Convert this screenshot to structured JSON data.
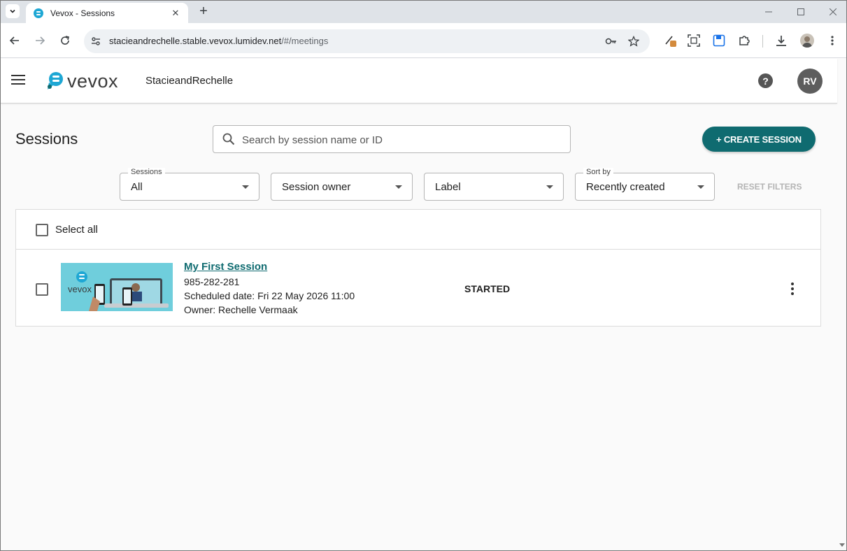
{
  "browser": {
    "tab_title": "Vevox - Sessions",
    "tab_close": "✕",
    "new_tab": "+",
    "url_host": "stacieandrechelle.stable.vevox.lumidev.net",
    "url_path": "/#/meetings"
  },
  "app": {
    "logo_text": "vevox",
    "org_name": "StacieandRechelle",
    "help": "?",
    "avatar_initials": "RV"
  },
  "page": {
    "title": "Sessions",
    "search_placeholder": "Search by session name or ID",
    "create_button": "+ CREATE SESSION"
  },
  "filters": {
    "sessions": {
      "legend": "Sessions",
      "value": "All"
    },
    "owner": {
      "value": "Session owner"
    },
    "label": {
      "value": "Label"
    },
    "sort": {
      "legend": "Sort by",
      "value": "Recently created"
    },
    "reset": "RESET FILTERS"
  },
  "list": {
    "select_all": "Select all",
    "items": [
      {
        "name": "My First Session",
        "id": "985-282-281",
        "scheduled": "Scheduled date: Fri 22 May 2026 11:00",
        "owner": "Owner: Rechelle Vermaak",
        "status": "STARTED"
      }
    ]
  },
  "colors": {
    "brand_teal": "#0f6b70",
    "logo_blue": "#1ea7d4"
  }
}
